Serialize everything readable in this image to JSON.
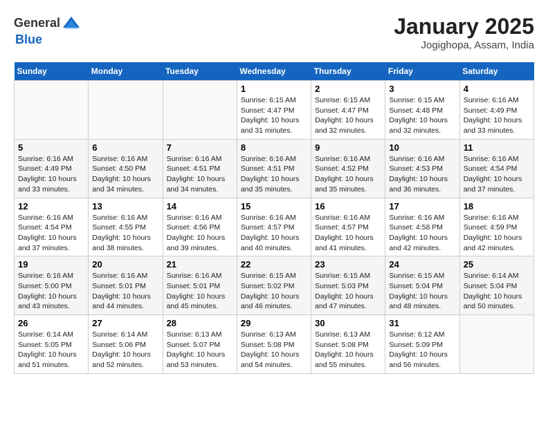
{
  "header": {
    "logo": {
      "general": "General",
      "blue": "Blue"
    },
    "title": "January 2025",
    "subtitle": "Jogighopa, Assam, India"
  },
  "days_of_week": [
    "Sunday",
    "Monday",
    "Tuesday",
    "Wednesday",
    "Thursday",
    "Friday",
    "Saturday"
  ],
  "weeks": [
    [
      {
        "day": "",
        "info": ""
      },
      {
        "day": "",
        "info": ""
      },
      {
        "day": "",
        "info": ""
      },
      {
        "day": "1",
        "info": "Sunrise: 6:15 AM\nSunset: 4:47 PM\nDaylight: 10 hours\nand 31 minutes."
      },
      {
        "day": "2",
        "info": "Sunrise: 6:15 AM\nSunset: 4:47 PM\nDaylight: 10 hours\nand 32 minutes."
      },
      {
        "day": "3",
        "info": "Sunrise: 6:15 AM\nSunset: 4:48 PM\nDaylight: 10 hours\nand 32 minutes."
      },
      {
        "day": "4",
        "info": "Sunrise: 6:16 AM\nSunset: 4:49 PM\nDaylight: 10 hours\nand 33 minutes."
      }
    ],
    [
      {
        "day": "5",
        "info": "Sunrise: 6:16 AM\nSunset: 4:49 PM\nDaylight: 10 hours\nand 33 minutes."
      },
      {
        "day": "6",
        "info": "Sunrise: 6:16 AM\nSunset: 4:50 PM\nDaylight: 10 hours\nand 34 minutes."
      },
      {
        "day": "7",
        "info": "Sunrise: 6:16 AM\nSunset: 4:51 PM\nDaylight: 10 hours\nand 34 minutes."
      },
      {
        "day": "8",
        "info": "Sunrise: 6:16 AM\nSunset: 4:51 PM\nDaylight: 10 hours\nand 35 minutes."
      },
      {
        "day": "9",
        "info": "Sunrise: 6:16 AM\nSunset: 4:52 PM\nDaylight: 10 hours\nand 35 minutes."
      },
      {
        "day": "10",
        "info": "Sunrise: 6:16 AM\nSunset: 4:53 PM\nDaylight: 10 hours\nand 36 minutes."
      },
      {
        "day": "11",
        "info": "Sunrise: 6:16 AM\nSunset: 4:54 PM\nDaylight: 10 hours\nand 37 minutes."
      }
    ],
    [
      {
        "day": "12",
        "info": "Sunrise: 6:16 AM\nSunset: 4:54 PM\nDaylight: 10 hours\nand 37 minutes."
      },
      {
        "day": "13",
        "info": "Sunrise: 6:16 AM\nSunset: 4:55 PM\nDaylight: 10 hours\nand 38 minutes."
      },
      {
        "day": "14",
        "info": "Sunrise: 6:16 AM\nSunset: 4:56 PM\nDaylight: 10 hours\nand 39 minutes."
      },
      {
        "day": "15",
        "info": "Sunrise: 6:16 AM\nSunset: 4:57 PM\nDaylight: 10 hours\nand 40 minutes."
      },
      {
        "day": "16",
        "info": "Sunrise: 6:16 AM\nSunset: 4:57 PM\nDaylight: 10 hours\nand 41 minutes."
      },
      {
        "day": "17",
        "info": "Sunrise: 6:16 AM\nSunset: 4:58 PM\nDaylight: 10 hours\nand 42 minutes."
      },
      {
        "day": "18",
        "info": "Sunrise: 6:16 AM\nSunset: 4:59 PM\nDaylight: 10 hours\nand 42 minutes."
      }
    ],
    [
      {
        "day": "19",
        "info": "Sunrise: 6:16 AM\nSunset: 5:00 PM\nDaylight: 10 hours\nand 43 minutes."
      },
      {
        "day": "20",
        "info": "Sunrise: 6:16 AM\nSunset: 5:01 PM\nDaylight: 10 hours\nand 44 minutes."
      },
      {
        "day": "21",
        "info": "Sunrise: 6:16 AM\nSunset: 5:01 PM\nDaylight: 10 hours\nand 45 minutes."
      },
      {
        "day": "22",
        "info": "Sunrise: 6:15 AM\nSunset: 5:02 PM\nDaylight: 10 hours\nand 46 minutes."
      },
      {
        "day": "23",
        "info": "Sunrise: 6:15 AM\nSunset: 5:03 PM\nDaylight: 10 hours\nand 47 minutes."
      },
      {
        "day": "24",
        "info": "Sunrise: 6:15 AM\nSunset: 5:04 PM\nDaylight: 10 hours\nand 48 minutes."
      },
      {
        "day": "25",
        "info": "Sunrise: 6:14 AM\nSunset: 5:04 PM\nDaylight: 10 hours\nand 50 minutes."
      }
    ],
    [
      {
        "day": "26",
        "info": "Sunrise: 6:14 AM\nSunset: 5:05 PM\nDaylight: 10 hours\nand 51 minutes."
      },
      {
        "day": "27",
        "info": "Sunrise: 6:14 AM\nSunset: 5:06 PM\nDaylight: 10 hours\nand 52 minutes."
      },
      {
        "day": "28",
        "info": "Sunrise: 6:13 AM\nSunset: 5:07 PM\nDaylight: 10 hours\nand 53 minutes."
      },
      {
        "day": "29",
        "info": "Sunrise: 6:13 AM\nSunset: 5:08 PM\nDaylight: 10 hours\nand 54 minutes."
      },
      {
        "day": "30",
        "info": "Sunrise: 6:13 AM\nSunset: 5:08 PM\nDaylight: 10 hours\nand 55 minutes."
      },
      {
        "day": "31",
        "info": "Sunrise: 6:12 AM\nSunset: 5:09 PM\nDaylight: 10 hours\nand 56 minutes."
      },
      {
        "day": "",
        "info": ""
      }
    ]
  ]
}
